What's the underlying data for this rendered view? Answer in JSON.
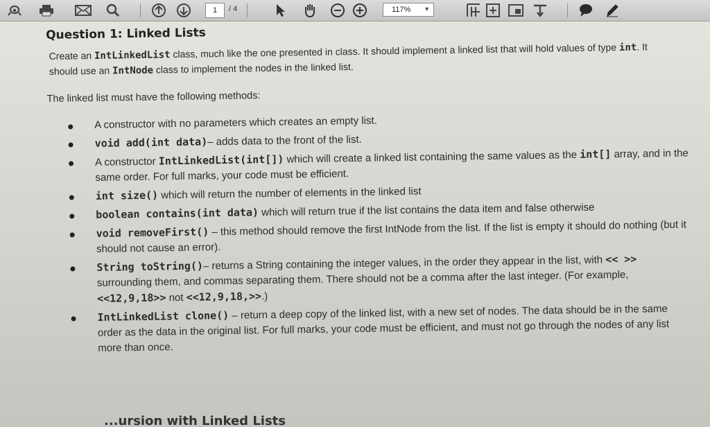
{
  "toolbar": {
    "current_page": "1",
    "page_total": "/ 4",
    "zoom": "117%",
    "icons": [
      "share-icon",
      "print-icon",
      "mail-icon",
      "search-icon",
      "page-up-icon",
      "page-down-icon",
      "select-icon",
      "hand-icon",
      "zoom-out-icon",
      "zoom-in-icon",
      "fit-page-icon",
      "fit-width-icon",
      "fullscreen-icon",
      "pin-icon",
      "comment-icon",
      "pen-icon"
    ],
    "accent_colors": {
      "comment": "#2a2a2a",
      "pen": "#2a2a2a"
    }
  },
  "document": {
    "title": "Question 1: Linked Lists",
    "intro_line1_a": "Create an ",
    "intro_cls": "IntLinkedList",
    "intro_line1_b": " class, much like the one presented in class. It should implement a linked list that will hold values of type ",
    "intro_type": "int",
    "intro_line1_c": ". It should use an ",
    "intro_node": "IntNode",
    "intro_line1_d": " class to implement the nodes in the linked list.",
    "lead": "The linked list must have the following methods:",
    "items": [
      {
        "sig": "",
        "text": "A constructor with no parameters which creates an empty list."
      },
      {
        "sig": "void add(int data)",
        "text": "– adds data to the front of the list."
      },
      {
        "sig_pre": "A constructor ",
        "sig": "IntLinkedList(int[])",
        "text": " which will create a linked list containing the same values as the ",
        "sig2": "int[]",
        "text2": " array, and in the same order. For full marks, your code must be efficient."
      },
      {
        "sig": "int size()",
        "text": " which will return the number of elements in the linked list"
      },
      {
        "sig": "boolean contains(int data)",
        "text": " which will return true if the list contains the data item and false otherwise"
      },
      {
        "sig": "void removeFirst()",
        "text": " – this method should remove the first IntNode from the list. If the list is empty it should do nothing (but it should not cause an error)."
      },
      {
        "sig": "String toString()",
        "text": "– returns a String containing the integer values, in the order they appear in the list, with ",
        "sig2": "<< >>",
        "text2": " surrounding them, and commas separating them. There should not be a comma after the last integer. (For example, ",
        "sig3": "<<12,9,18>>",
        "text3": " not ",
        "sig4": "<<12,9,18,>>",
        "text4": ".)"
      },
      {
        "sig": "IntLinkedList clone()",
        "text": " – return a deep copy of the linked list, with a new set of nodes. The data should be in the same order as the data in the original list. For full marks, your code must be efficient, and must not go through the nodes of any list more than once."
      }
    ],
    "next_heading": "...ursion with Linked Lists"
  }
}
